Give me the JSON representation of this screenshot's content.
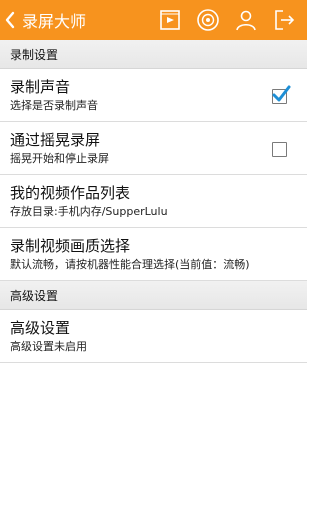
{
  "app": {
    "title": "录屏大师",
    "accent": "#f7931e"
  },
  "toolbar": {
    "icons": [
      "back-chevron-icon",
      "video-play-icon",
      "record-target-icon",
      "user-icon",
      "exit-icon"
    ]
  },
  "sections": {
    "record": {
      "header": "录制设置",
      "items": [
        {
          "title": "录制声音",
          "subtitle": "选择是否录制声音",
          "checked": true
        },
        {
          "title": "通过摇晃录屏",
          "subtitle": "摇晃开始和停止录屏",
          "checked": false
        },
        {
          "title": "我的视频作品列表",
          "subtitle": "存放目录:手机内存/SupperLulu"
        },
        {
          "title": "录制视频画质选择",
          "subtitle": "默认流畅，请按机器性能合理选择(当前值：流畅)"
        }
      ]
    },
    "advanced": {
      "header": "高级设置",
      "items": [
        {
          "title": "高级设置",
          "subtitle": "高级设置未启用"
        }
      ]
    }
  }
}
